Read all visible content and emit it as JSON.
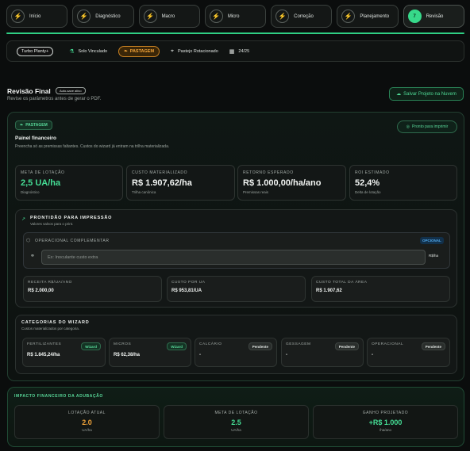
{
  "steps": [
    {
      "label": "Início",
      "icon": "bolt-icon"
    },
    {
      "label": "Diagnóstico",
      "icon": "bolt-icon"
    },
    {
      "label": "Macro",
      "icon": "bolt-icon"
    },
    {
      "label": "Micro",
      "icon": "bolt-icon"
    },
    {
      "label": "Correção",
      "icon": "bolt-icon"
    },
    {
      "label": "Planejamento",
      "icon": "bolt-icon"
    },
    {
      "label": "Revisão",
      "number": "7"
    }
  ],
  "infobar": {
    "pill": "Turbo Planty+",
    "solo": "Solo Vinculado",
    "culture": "PASTAGEM",
    "talhao": "Pastejo Rotacionado",
    "season": "24/25"
  },
  "header": {
    "title": "Revisão Final",
    "autosave": "Auto-save ativo",
    "subtitle": "Revise os parâmetros antes de gerar o PDF.",
    "save_button": "Salvar Projeto na Nuvem"
  },
  "panel": {
    "tag": "PASTAGEM",
    "ready_button": "Pronto para imprimir",
    "title": "Painel financeiro",
    "subtitle": "Preencha só as premissas faltantes. Custos do wizard já entram na trilha materializada."
  },
  "metrics": [
    {
      "label": "META DE LOTAÇÃO",
      "value": "2,5 UA/ha",
      "sub": "Diagnóstico",
      "green": true
    },
    {
      "label": "CUSTO MATERIALIZADO",
      "value": "R$ 1.907,62/ha",
      "sub": "Trilha canônica",
      "green": false
    },
    {
      "label": "RETORNO ESPERADO",
      "value": "R$ 1.000,00/ha/ano",
      "sub": "Premissas reais",
      "green": false
    },
    {
      "label": "ROI ESTIMADO",
      "value": "52,4%",
      "sub": "Delta de lotação",
      "green": false
    }
  ],
  "print": {
    "title": "PRONTIDÃO PARA IMPRESSÃO",
    "subtitle": "Valores salvos para o print.",
    "operational_title": "OPERACIONAL COMPLEMENTAR",
    "operational_badge": "OPCIONAL",
    "input_placeholder": "Ex: Inoculante custo extra",
    "unit": "R$/ha"
  },
  "small_metrics": [
    {
      "label": "RECEITA R$/UA/ANO",
      "value": "R$ 2.000,00"
    },
    {
      "label": "CUSTO POR UA",
      "value": "R$ 953,81/UA"
    },
    {
      "label": "CUSTO TOTAL DA ÁREA",
      "value": "R$ 1.907,62"
    }
  ],
  "categories": {
    "title": "CATEGORIAS DO WIZARD",
    "subtitle": "Custos materializados por categoria.",
    "items": [
      {
        "label": "FERTILIZANTES",
        "badge": "Wizard",
        "value": "R$ 1.845,24/ha",
        "kind": "wiz"
      },
      {
        "label": "MICROS",
        "badge": "Wizard",
        "value": "R$ 62,38/ha",
        "kind": "wiz"
      },
      {
        "label": "CALCÁRIO",
        "badge": "Pendente",
        "value": "-",
        "kind": "pend"
      },
      {
        "label": "GESSAGEM",
        "badge": "Pendente",
        "value": "-",
        "kind": "pend"
      },
      {
        "label": "OPERACIONAL",
        "badge": "Pendente",
        "value": "-",
        "kind": "pend"
      }
    ]
  },
  "impact": {
    "title": "IMPACTO FINANCEIRO DA ADUBAÇÃO",
    "boxes": [
      {
        "label": "LOTAÇÃO ATUAL",
        "value": "2.0",
        "unit": "UA/ha",
        "color": "orange"
      },
      {
        "label": "META DE LOTAÇÃO",
        "value": "2.5",
        "unit": "UA/ha",
        "color": "green"
      },
      {
        "label": "GANHO PROJETADO",
        "value": "+R$ 1.000",
        "unit": "/ha/ano",
        "color": "green"
      }
    ]
  },
  "colors": {
    "accent": "#37d98a",
    "warning": "#f1a33a",
    "info": "#4fa7ea"
  }
}
